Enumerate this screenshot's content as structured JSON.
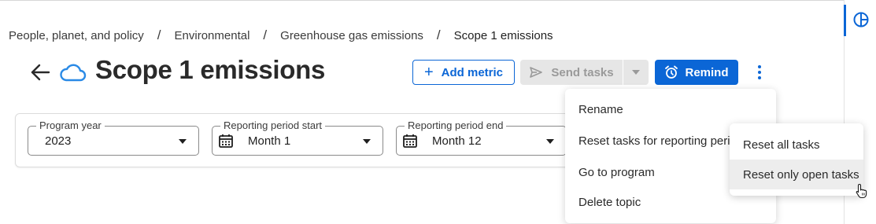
{
  "breadcrumb": {
    "items": [
      "People, planet, and policy",
      "Environmental",
      "Greenhouse gas emissions",
      "Scope 1 emissions"
    ],
    "separator": "/"
  },
  "header": {
    "title": "Scope 1 emissions",
    "add_metric_label": "Add metric",
    "send_tasks_label": "Send tasks",
    "remind_label": "Remind"
  },
  "filters": {
    "program_year": {
      "label": "Program year",
      "value": "2023"
    },
    "period_start": {
      "label": "Reporting period start",
      "value": "Month 1"
    },
    "period_end": {
      "label": "Reporting period end",
      "value": "Month 12"
    }
  },
  "menu": {
    "items": [
      "Rename",
      "Reset tasks for reporting period",
      "Go to program",
      "Delete topic"
    ]
  },
  "submenu": {
    "items": [
      "Reset all tasks",
      "Reset only open tasks"
    ],
    "hovered_index": 1
  },
  "colors": {
    "accent": "#0b66d6",
    "disabled_bg": "#e6e6e6",
    "cloud": "#2a8ae6"
  },
  "icons": {
    "back": "arrow-left-icon",
    "topic": "cloud-icon",
    "add": "plus-icon",
    "send": "send-icon",
    "remind": "alarm-clock-icon",
    "more": "kebab-icon",
    "calendar": "calendar-icon",
    "rail": "pie-chart-icon"
  }
}
